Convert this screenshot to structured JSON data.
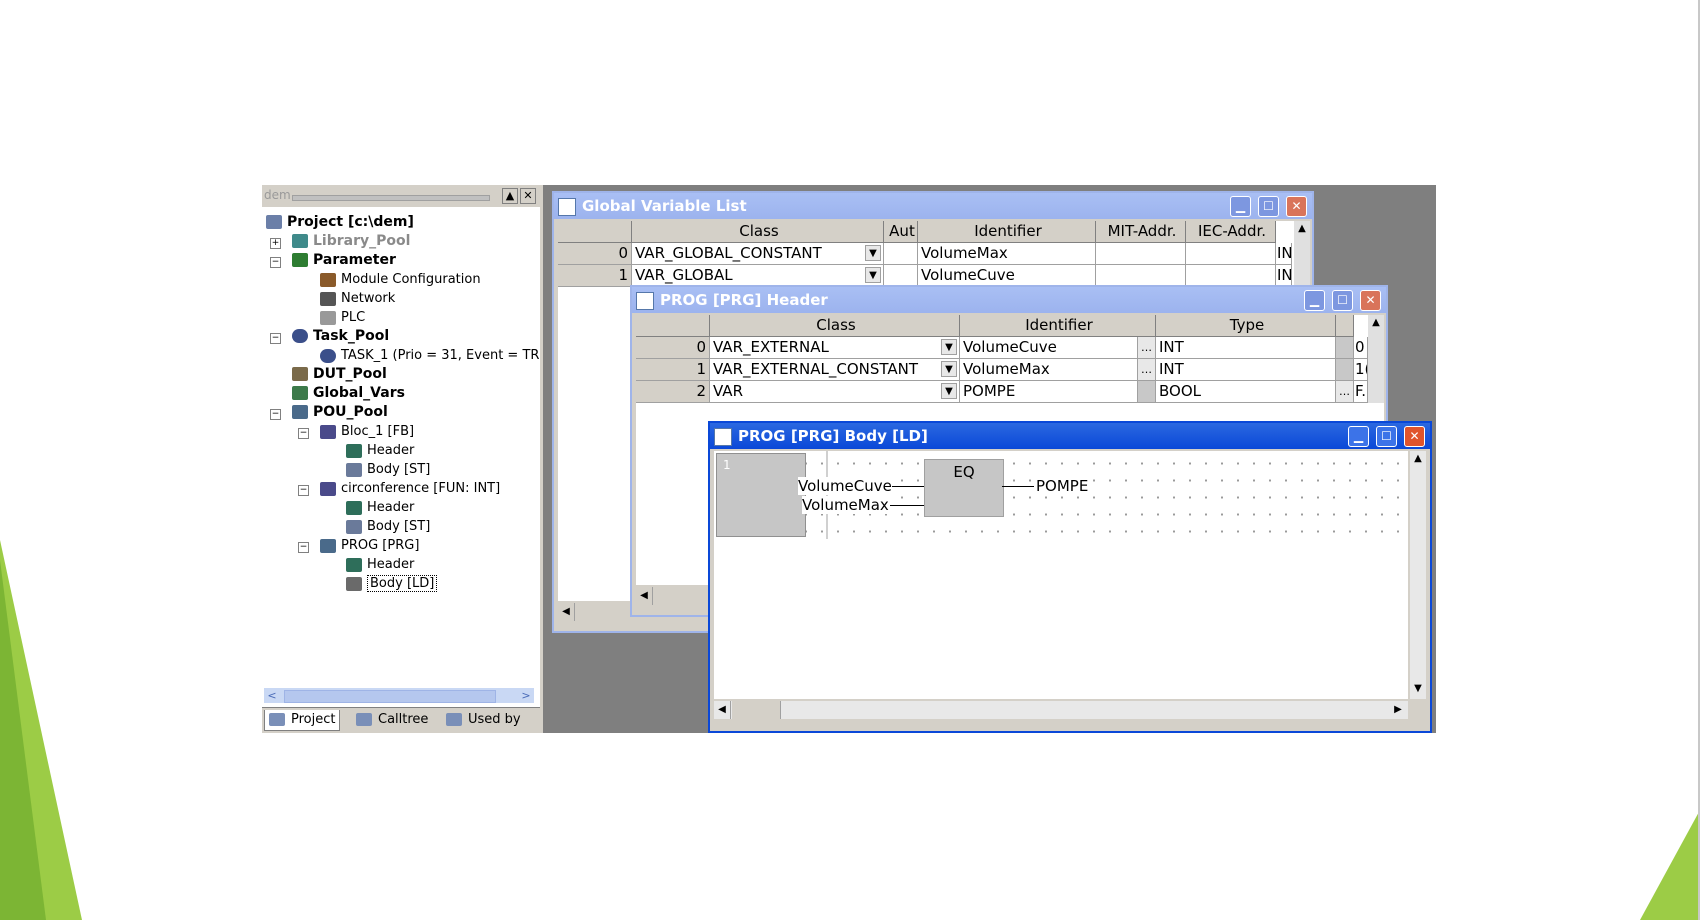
{
  "explorer": {
    "header_label": "dem",
    "tree": [
      {
        "label": "Project [c:\\dem]",
        "icon": "project-icon"
      },
      {
        "label": "Library_Pool",
        "icon": "library-icon"
      },
      {
        "label": "Parameter",
        "icon": "parameter-icon"
      },
      {
        "label": "Module Configuration",
        "icon": "module-icon"
      },
      {
        "label": "Network",
        "icon": "network-icon"
      },
      {
        "label": "PLC",
        "icon": "plc-icon"
      },
      {
        "label": "Task_Pool",
        "icon": "clock-icon"
      },
      {
        "label": "TASK_1 (Prio = 31, Event = TR",
        "icon": "clock-icon"
      },
      {
        "label": "DUT_Pool",
        "icon": "dut-icon"
      },
      {
        "label": "Global_Vars",
        "icon": "globals-icon"
      },
      {
        "label": "POU_Pool",
        "icon": "pou-icon"
      },
      {
        "label": "Bloc_1 [FB]",
        "icon": "fb-icon"
      },
      {
        "label": "Header",
        "icon": "header-icon"
      },
      {
        "label": "Body [ST]",
        "icon": "st-icon"
      },
      {
        "label": "circonference [FUN: INT]",
        "icon": "fun-icon"
      },
      {
        "label": "Header",
        "icon": "header-icon"
      },
      {
        "label": "Body [ST]",
        "icon": "st-icon"
      },
      {
        "label": "PROG [PRG]",
        "icon": "prg-icon"
      },
      {
        "label": "Header",
        "icon": "header-icon"
      },
      {
        "label": "Body [LD]",
        "icon": "ld-icon"
      }
    ],
    "tabs": [
      {
        "label": "Project"
      },
      {
        "label": "Calltree"
      },
      {
        "label": "Used by"
      }
    ]
  },
  "gvl": {
    "title": "Global Variable List",
    "columns": [
      "Class",
      "Aut",
      "Identifier",
      "MIT-Addr.",
      "IEC-Addr."
    ],
    "rows": [
      {
        "num": "0",
        "class": "VAR_GLOBAL_CONSTANT",
        "identifier": "VolumeMax",
        "trunc": "IN"
      },
      {
        "num": "1",
        "class": "VAR_GLOBAL",
        "identifier": "VolumeCuve",
        "trunc": "IN"
      }
    ]
  },
  "header": {
    "title": "PROG [PRG] Header",
    "columns": [
      "Class",
      "Identifier",
      "Type"
    ],
    "rows": [
      {
        "num": "0",
        "class": "VAR_EXTERNAL",
        "identifier": "VolumeCuve",
        "type": "INT",
        "trunc": "0"
      },
      {
        "num": "1",
        "class": "VAR_EXTERNAL_CONSTANT",
        "identifier": "VolumeMax",
        "type": "INT",
        "trunc": "1("
      },
      {
        "num": "2",
        "class": "VAR",
        "identifier": "POMPE",
        "type": "BOOL",
        "trunc": "F."
      }
    ]
  },
  "body": {
    "title": "PROG [PRG] Body [LD]",
    "rung_number": "1",
    "block": "EQ",
    "input1": "VolumeCuve",
    "input2": "VolumeMax",
    "output": "POMPE"
  },
  "colors": {
    "green_light": "#9ccc46",
    "green_dark": "#6fa52b",
    "title_active": "#0a48d8",
    "title_inactive": "#a9bff4",
    "close_btn": "#e0542c"
  }
}
